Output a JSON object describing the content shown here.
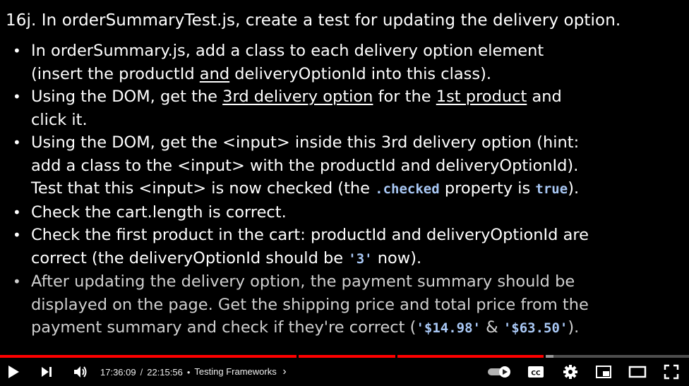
{
  "slide": {
    "heading": "16j. In orderSummaryTest.js, create a test for updating the delivery option.",
    "b1": {
      "l1": "In orderSummary.js, add a class to each delivery option element",
      "l2a": "(insert the productId ",
      "l2u": "and",
      "l2b": " deliveryOptionId into this class)."
    },
    "b2": {
      "l1a": "Using the DOM, get the ",
      "l1u1": "3rd delivery option",
      "l1b": " for the ",
      "l1u2": "1st product",
      "l1c": " and",
      "l2": "click it."
    },
    "b3": {
      "l1": "Using the DOM, get the <input> inside this 3rd delivery option (hint:",
      "l2": "add a class to the <input> with the productId and deliveryOptionId).",
      "l3a": "Test that this <input> is now checked (the ",
      "l3code1": ".checked",
      "l3b": " property is ",
      "l3code2": "true",
      "l3c": ")."
    },
    "b4": {
      "l1": "Check the cart.length is correct."
    },
    "b5": {
      "l1": "Check the first product in the cart: productId and deliveryOptionId are",
      "l2a": "correct (the deliveryOptionId should be ",
      "l2code": "'3'",
      "l2b": " now)."
    },
    "b6": {
      "l1": "After updating the delivery option, the payment summary should be",
      "l2": "displayed on the page. Get the shipping price and total price from the",
      "l3a": "payment summary and check if they're correct (",
      "l3code1": "'$14.98'",
      "l3b": " & ",
      "l3code2": "'$63.50'",
      "l3c": ")."
    }
  },
  "player": {
    "current_time": "17:36:09",
    "separator": "/",
    "total_time": "22:15:56",
    "dot": "•",
    "chapter": "Testing Frameworks",
    "chapter_chevron": "›",
    "progress_fraction": 0.791,
    "buffer_fraction": 0.803,
    "icons": [
      "play-icon",
      "next-icon",
      "volume-icon",
      "autoplay-toggle-icon",
      "captions-icon",
      "settings-icon",
      "miniplayer-icon",
      "theater-icon",
      "fullscreen-icon"
    ],
    "cc_label": "CC",
    "accent": "#ff0000"
  }
}
